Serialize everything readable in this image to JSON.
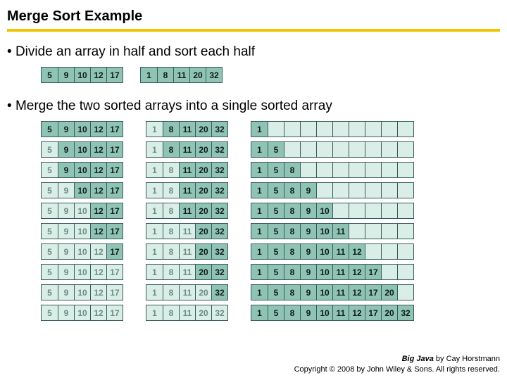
{
  "title": "Merge Sort Example",
  "bullets": {
    "divide": "Divide an array in half and sort each half",
    "merge": "Merge the two sorted arrays into a single sorted array"
  },
  "divided": {
    "left": [
      "5",
      "9",
      "10",
      "12",
      "17"
    ],
    "right": [
      "1",
      "8",
      "11",
      "20",
      "32"
    ]
  },
  "chart_data": {
    "type": "table",
    "description": "Merge sort merging steps. Each step shows the state of the two source halves (front elements already consumed shown faded/empty) and the growing merged result. 'filled' cells are active/unconsumed in sources or already placed in result; 'empty' cells are consumed-source or not-yet-filled result slots.",
    "steps": [
      {
        "left": [
          {
            "v": "5",
            "f": true
          },
          {
            "v": "9",
            "f": true
          },
          {
            "v": "10",
            "f": true
          },
          {
            "v": "12",
            "f": true
          },
          {
            "v": "17",
            "f": true
          }
        ],
        "right": [
          {
            "v": "1",
            "f": false
          },
          {
            "v": "8",
            "f": true
          },
          {
            "v": "11",
            "f": true
          },
          {
            "v": "20",
            "f": true
          },
          {
            "v": "32",
            "f": true
          }
        ],
        "result": [
          {
            "v": "1",
            "f": true
          },
          {
            "v": "",
            "f": false
          },
          {
            "v": "",
            "f": false
          },
          {
            "v": "",
            "f": false
          },
          {
            "v": "",
            "f": false
          },
          {
            "v": "",
            "f": false
          },
          {
            "v": "",
            "f": false
          },
          {
            "v": "",
            "f": false
          },
          {
            "v": "",
            "f": false
          },
          {
            "v": "",
            "f": false
          }
        ]
      },
      {
        "left": [
          {
            "v": "5",
            "f": false
          },
          {
            "v": "9",
            "f": true
          },
          {
            "v": "10",
            "f": true
          },
          {
            "v": "12",
            "f": true
          },
          {
            "v": "17",
            "f": true
          }
        ],
        "right": [
          {
            "v": "1",
            "f": false
          },
          {
            "v": "8",
            "f": true
          },
          {
            "v": "11",
            "f": true
          },
          {
            "v": "20",
            "f": true
          },
          {
            "v": "32",
            "f": true
          }
        ],
        "result": [
          {
            "v": "1",
            "f": true
          },
          {
            "v": "5",
            "f": true
          },
          {
            "v": "",
            "f": false
          },
          {
            "v": "",
            "f": false
          },
          {
            "v": "",
            "f": false
          },
          {
            "v": "",
            "f": false
          },
          {
            "v": "",
            "f": false
          },
          {
            "v": "",
            "f": false
          },
          {
            "v": "",
            "f": false
          },
          {
            "v": "",
            "f": false
          }
        ]
      },
      {
        "left": [
          {
            "v": "5",
            "f": false
          },
          {
            "v": "9",
            "f": true
          },
          {
            "v": "10",
            "f": true
          },
          {
            "v": "12",
            "f": true
          },
          {
            "v": "17",
            "f": true
          }
        ],
        "right": [
          {
            "v": "1",
            "f": false
          },
          {
            "v": "8",
            "f": false
          },
          {
            "v": "11",
            "f": true
          },
          {
            "v": "20",
            "f": true
          },
          {
            "v": "32",
            "f": true
          }
        ],
        "result": [
          {
            "v": "1",
            "f": true
          },
          {
            "v": "5",
            "f": true
          },
          {
            "v": "8",
            "f": true
          },
          {
            "v": "",
            "f": false
          },
          {
            "v": "",
            "f": false
          },
          {
            "v": "",
            "f": false
          },
          {
            "v": "",
            "f": false
          },
          {
            "v": "",
            "f": false
          },
          {
            "v": "",
            "f": false
          },
          {
            "v": "",
            "f": false
          }
        ]
      },
      {
        "left": [
          {
            "v": "5",
            "f": false
          },
          {
            "v": "9",
            "f": false
          },
          {
            "v": "10",
            "f": true
          },
          {
            "v": "12",
            "f": true
          },
          {
            "v": "17",
            "f": true
          }
        ],
        "right": [
          {
            "v": "1",
            "f": false
          },
          {
            "v": "8",
            "f": false
          },
          {
            "v": "11",
            "f": true
          },
          {
            "v": "20",
            "f": true
          },
          {
            "v": "32",
            "f": true
          }
        ],
        "result": [
          {
            "v": "1",
            "f": true
          },
          {
            "v": "5",
            "f": true
          },
          {
            "v": "8",
            "f": true
          },
          {
            "v": "9",
            "f": true
          },
          {
            "v": "",
            "f": false
          },
          {
            "v": "",
            "f": false
          },
          {
            "v": "",
            "f": false
          },
          {
            "v": "",
            "f": false
          },
          {
            "v": "",
            "f": false
          },
          {
            "v": "",
            "f": false
          }
        ]
      },
      {
        "left": [
          {
            "v": "5",
            "f": false
          },
          {
            "v": "9",
            "f": false
          },
          {
            "v": "10",
            "f": false
          },
          {
            "v": "12",
            "f": true
          },
          {
            "v": "17",
            "f": true
          }
        ],
        "right": [
          {
            "v": "1",
            "f": false
          },
          {
            "v": "8",
            "f": false
          },
          {
            "v": "11",
            "f": true
          },
          {
            "v": "20",
            "f": true
          },
          {
            "v": "32",
            "f": true
          }
        ],
        "result": [
          {
            "v": "1",
            "f": true
          },
          {
            "v": "5",
            "f": true
          },
          {
            "v": "8",
            "f": true
          },
          {
            "v": "9",
            "f": true
          },
          {
            "v": "10",
            "f": true
          },
          {
            "v": "",
            "f": false
          },
          {
            "v": "",
            "f": false
          },
          {
            "v": "",
            "f": false
          },
          {
            "v": "",
            "f": false
          },
          {
            "v": "",
            "f": false
          }
        ]
      },
      {
        "left": [
          {
            "v": "5",
            "f": false
          },
          {
            "v": "9",
            "f": false
          },
          {
            "v": "10",
            "f": false
          },
          {
            "v": "12",
            "f": true
          },
          {
            "v": "17",
            "f": true
          }
        ],
        "right": [
          {
            "v": "1",
            "f": false
          },
          {
            "v": "8",
            "f": false
          },
          {
            "v": "11",
            "f": false
          },
          {
            "v": "20",
            "f": true
          },
          {
            "v": "32",
            "f": true
          }
        ],
        "result": [
          {
            "v": "1",
            "f": true
          },
          {
            "v": "5",
            "f": true
          },
          {
            "v": "8",
            "f": true
          },
          {
            "v": "9",
            "f": true
          },
          {
            "v": "10",
            "f": true
          },
          {
            "v": "11",
            "f": true
          },
          {
            "v": "",
            "f": false
          },
          {
            "v": "",
            "f": false
          },
          {
            "v": "",
            "f": false
          },
          {
            "v": "",
            "f": false
          }
        ]
      },
      {
        "left": [
          {
            "v": "5",
            "f": false
          },
          {
            "v": "9",
            "f": false
          },
          {
            "v": "10",
            "f": false
          },
          {
            "v": "12",
            "f": false
          },
          {
            "v": "17",
            "f": true
          }
        ],
        "right": [
          {
            "v": "1",
            "f": false
          },
          {
            "v": "8",
            "f": false
          },
          {
            "v": "11",
            "f": false
          },
          {
            "v": "20",
            "f": true
          },
          {
            "v": "32",
            "f": true
          }
        ],
        "result": [
          {
            "v": "1",
            "f": true
          },
          {
            "v": "5",
            "f": true
          },
          {
            "v": "8",
            "f": true
          },
          {
            "v": "9",
            "f": true
          },
          {
            "v": "10",
            "f": true
          },
          {
            "v": "11",
            "f": true
          },
          {
            "v": "12",
            "f": true
          },
          {
            "v": "",
            "f": false
          },
          {
            "v": "",
            "f": false
          },
          {
            "v": "",
            "f": false
          }
        ]
      },
      {
        "left": [
          {
            "v": "5",
            "f": false
          },
          {
            "v": "9",
            "f": false
          },
          {
            "v": "10",
            "f": false
          },
          {
            "v": "12",
            "f": false
          },
          {
            "v": "17",
            "f": false
          }
        ],
        "right": [
          {
            "v": "1",
            "f": false
          },
          {
            "v": "8",
            "f": false
          },
          {
            "v": "11",
            "f": false
          },
          {
            "v": "20",
            "f": true
          },
          {
            "v": "32",
            "f": true
          }
        ],
        "result": [
          {
            "v": "1",
            "f": true
          },
          {
            "v": "5",
            "f": true
          },
          {
            "v": "8",
            "f": true
          },
          {
            "v": "9",
            "f": true
          },
          {
            "v": "10",
            "f": true
          },
          {
            "v": "11",
            "f": true
          },
          {
            "v": "12",
            "f": true
          },
          {
            "v": "17",
            "f": true
          },
          {
            "v": "",
            "f": false
          },
          {
            "v": "",
            "f": false
          }
        ]
      },
      {
        "left": [
          {
            "v": "5",
            "f": false
          },
          {
            "v": "9",
            "f": false
          },
          {
            "v": "10",
            "f": false
          },
          {
            "v": "12",
            "f": false
          },
          {
            "v": "17",
            "f": false
          }
        ],
        "right": [
          {
            "v": "1",
            "f": false
          },
          {
            "v": "8",
            "f": false
          },
          {
            "v": "11",
            "f": false
          },
          {
            "v": "20",
            "f": false
          },
          {
            "v": "32",
            "f": true
          }
        ],
        "result": [
          {
            "v": "1",
            "f": true
          },
          {
            "v": "5",
            "f": true
          },
          {
            "v": "8",
            "f": true
          },
          {
            "v": "9",
            "f": true
          },
          {
            "v": "10",
            "f": true
          },
          {
            "v": "11",
            "f": true
          },
          {
            "v": "12",
            "f": true
          },
          {
            "v": "17",
            "f": true
          },
          {
            "v": "20",
            "f": true
          },
          {
            "v": "",
            "f": false
          }
        ]
      },
      {
        "left": [
          {
            "v": "5",
            "f": false
          },
          {
            "v": "9",
            "f": false
          },
          {
            "v": "10",
            "f": false
          },
          {
            "v": "12",
            "f": false
          },
          {
            "v": "17",
            "f": false
          }
        ],
        "right": [
          {
            "v": "1",
            "f": false
          },
          {
            "v": "8",
            "f": false
          },
          {
            "v": "11",
            "f": false
          },
          {
            "v": "20",
            "f": false
          },
          {
            "v": "32",
            "f": false
          }
        ],
        "result": [
          {
            "v": "1",
            "f": true
          },
          {
            "v": "5",
            "f": true
          },
          {
            "v": "8",
            "f": true
          },
          {
            "v": "9",
            "f": true
          },
          {
            "v": "10",
            "f": true
          },
          {
            "v": "11",
            "f": true
          },
          {
            "v": "12",
            "f": true
          },
          {
            "v": "17",
            "f": true
          },
          {
            "v": "20",
            "f": true
          },
          {
            "v": "32",
            "f": true
          }
        ]
      }
    ]
  },
  "footer": {
    "book": "Big Java",
    "author": " by Cay Horstmann",
    "copyright": "Copyright © 2008 by John Wiley & Sons. All rights reserved."
  }
}
